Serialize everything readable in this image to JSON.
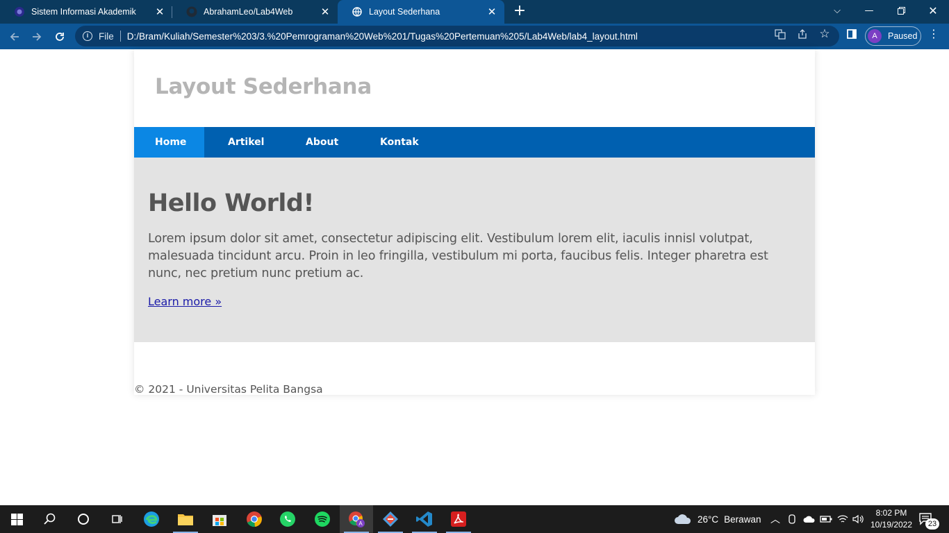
{
  "browser": {
    "tabs": [
      {
        "title": "Sistem Informasi Akademik",
        "active": false
      },
      {
        "title": "AbrahamLeo/Lab4Web",
        "active": false
      },
      {
        "title": "Layout Sederhana",
        "active": true
      }
    ],
    "address": {
      "scheme_label": "File",
      "url": "D:/Bram/Kuliah/Semester%203/3.%20Pemrograman%20Web%201/Tugas%20Pertemuan%205/Lab4Web/lab4_layout.html"
    },
    "profile": {
      "initial": "A",
      "status": "Paused"
    }
  },
  "page": {
    "site_title": "Layout Sederhana",
    "nav": [
      {
        "label": "Home",
        "active": true
      },
      {
        "label": "Artikel",
        "active": false
      },
      {
        "label": "About",
        "active": false
      },
      {
        "label": "Kontak",
        "active": false
      }
    ],
    "hero": {
      "heading": "Hello World!",
      "body": "Lorem ipsum dolor sit amet, consectetur adipiscing elit. Vestibulum lorem elit, iaculis innisl volutpat, malesuada tincidunt arcu. Proin in leo fringilla, vestibulum mi porta, faucibus felis. Integer pharetra est nunc, nec pretium nunc pretium ac.",
      "link": "Learn more »"
    },
    "footer": "© 2021 - Universitas Pelita Bangsa"
  },
  "taskbar": {
    "apps": [
      "start-icon",
      "search-icon",
      "cortana-icon",
      "task-view-icon",
      "edge-icon",
      "file-explorer-icon",
      "store-icon",
      "chrome-icon",
      "whatsapp-icon",
      "spotify-icon",
      "chrome-profile-icon",
      "git-icon",
      "vscode-icon",
      "acrobat-icon"
    ],
    "weather": {
      "temp": "26°C",
      "condition": "Berawan"
    },
    "time": "8:02 PM",
    "date": "10/19/2022",
    "notifications": "23"
  },
  "colors": {
    "tab_bar": "#0b3a5e",
    "toolbar": "#0d5696",
    "nav": "#0060b0",
    "nav_active": "#0b87e4",
    "hero_bg": "#e3e3e3",
    "title_gray": "#b5b5b5"
  }
}
